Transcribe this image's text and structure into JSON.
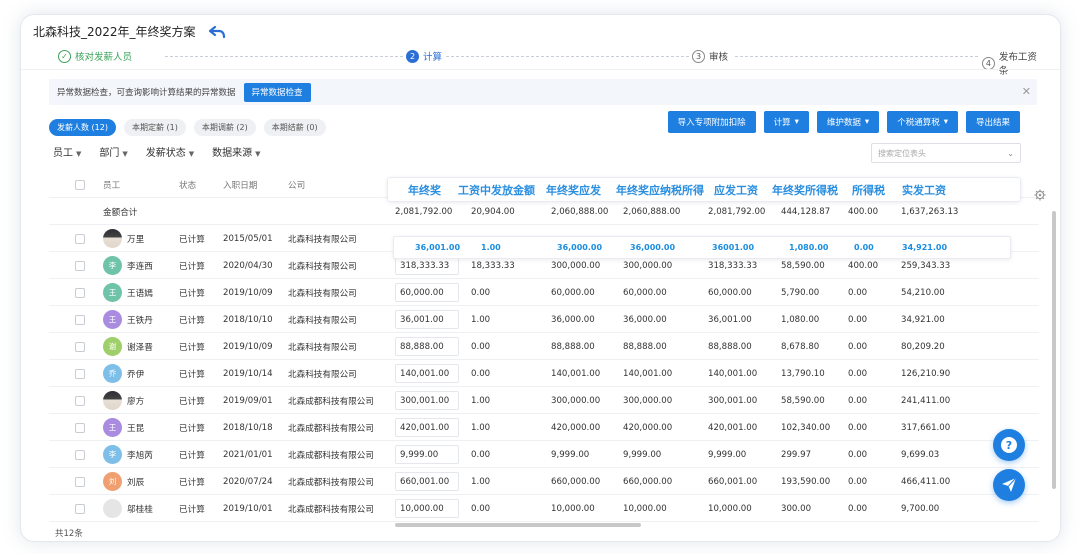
{
  "title": "北森科技_2022年_年终奖方案",
  "steps": [
    {
      "num": "✓",
      "label": "核对发薪人员",
      "state": "done"
    },
    {
      "num": "2",
      "label": "计算",
      "state": "active"
    },
    {
      "num": "3",
      "label": "审核",
      "state": "todo"
    },
    {
      "num": "4",
      "label": "发布工资条",
      "state": "todo"
    }
  ],
  "notice": {
    "text": "异常数据检查，可查询影响计算结果的异常数据",
    "button": "异常数据检查"
  },
  "toolbar": {
    "import": "导入专项附加扣除",
    "calc": "计算",
    "maintain": "维护数据",
    "tax": "个税通算税",
    "export": "导出结果"
  },
  "tabs": [
    "发薪人数 (12)",
    "本期定薪 (1)",
    "本期调薪 (2)",
    "本期结薪 (0)"
  ],
  "filters": [
    "员工",
    "部门",
    "发薪状态",
    "数据来源"
  ],
  "column_search": {
    "placeholder": "搜索定位表头"
  },
  "columns": [
    "员工",
    "状态",
    "入职日期",
    "公司"
  ],
  "overlay_columns": [
    "年终奖",
    "工资中发放金额",
    "年终奖应发",
    "年终奖应纳税所得",
    "应发工资",
    "年终奖所得税",
    "所得税",
    "实发工资"
  ],
  "totals": {
    "label": "金额合计",
    "values": [
      "2,081,792.00",
      "20,904.00",
      "2,060,888.00",
      "2,060,888.00",
      "2,081,792.00",
      "444,128.87",
      "400.00",
      "1,637,263.13"
    ]
  },
  "highlight_row": [
    "36,001.00",
    "1.00",
    "36,000.00",
    "36,000.00",
    "36001.00",
    "1,080.00",
    "0.00",
    "34,921.00"
  ],
  "rows": [
    {
      "avatar": "",
      "avatar_color": "#555555",
      "photo": true,
      "name": "万里",
      "status": "已计算",
      "date": "2015/05/01",
      "company": "北森科技有限公司",
      "values": []
    },
    {
      "avatar": "李",
      "avatar_color": "#6fc3a8",
      "photo": false,
      "name": "李连西",
      "status": "已计算",
      "date": "2020/04/30",
      "company": "北森科技有限公司",
      "values": [
        "318,333.33",
        "18,333.33",
        "300,000.00",
        "300,000.00",
        "318,333.33",
        "58,590.00",
        "400.00",
        "259,343.33"
      ]
    },
    {
      "avatar": "王",
      "avatar_color": "#6fc3a8",
      "photo": false,
      "name": "王语嫣",
      "status": "已计算",
      "date": "2019/10/09",
      "company": "北森科技有限公司",
      "values": [
        "60,000.00",
        "0.00",
        "60,000.00",
        "60,000.00",
        "60,000.00",
        "5,790.00",
        "0.00",
        "54,210.00"
      ]
    },
    {
      "avatar": "王",
      "avatar_color": "#a98be0",
      "photo": false,
      "name": "王铁丹",
      "status": "已计算",
      "date": "2018/10/10",
      "company": "北森科技有限公司",
      "values": [
        "36,001.00",
        "1.00",
        "36,000.00",
        "36,000.00",
        "36,001.00",
        "1,080.00",
        "0.00",
        "34,921.00"
      ]
    },
    {
      "avatar": "谢",
      "avatar_color": "#9fcf6a",
      "photo": false,
      "name": "谢泽晋",
      "status": "已计算",
      "date": "2019/10/09",
      "company": "北森科技有限公司",
      "values": [
        "88,888.00",
        "0.00",
        "88,888.00",
        "88,888.00",
        "88,888.00",
        "8,678.80",
        "0.00",
        "80,209.20"
      ]
    },
    {
      "avatar": "乔",
      "avatar_color": "#7dbfe8",
      "photo": false,
      "name": "乔伊",
      "status": "已计算",
      "date": "2019/10/14",
      "company": "北森科技有限公司",
      "values": [
        "140,001.00",
        "0.00",
        "140,001.00",
        "140,001.00",
        "140,001.00",
        "13,790.10",
        "0.00",
        "126,210.90"
      ]
    },
    {
      "avatar": "",
      "avatar_color": "#444444",
      "photo": true,
      "name": "廖方",
      "status": "已计算",
      "date": "2019/09/01",
      "company": "北森成都科技有限公司",
      "values": [
        "300,001.00",
        "1.00",
        "300,000.00",
        "300,000.00",
        "300,001.00",
        "58,590.00",
        "0.00",
        "241,411.00"
      ]
    },
    {
      "avatar": "王",
      "avatar_color": "#a98be0",
      "photo": false,
      "name": "王昆",
      "status": "已计算",
      "date": "2018/10/18",
      "company": "北森成都科技有限公司",
      "values": [
        "420,001.00",
        "1.00",
        "420,000.00",
        "420,000.00",
        "420,001.00",
        "102,340.00",
        "0.00",
        "317,661.00"
      ]
    },
    {
      "avatar": "李",
      "avatar_color": "#7dbfe8",
      "photo": false,
      "name": "李旭芮",
      "status": "已计算",
      "date": "2021/01/01",
      "company": "北森成都科技有限公司",
      "values": [
        "9,999.00",
        "0.00",
        "9,999.00",
        "9,999.00",
        "9,999.00",
        "299.97",
        "0.00",
        "9,699.03"
      ]
    },
    {
      "avatar": "刘",
      "avatar_color": "#f0a070",
      "photo": false,
      "name": "刘辰",
      "status": "已计算",
      "date": "2020/07/24",
      "company": "北森成都科技有限公司",
      "values": [
        "660,001.00",
        "1.00",
        "660,000.00",
        "660,000.00",
        "660,001.00",
        "193,590.00",
        "0.00",
        "466,411.00"
      ]
    },
    {
      "avatar": "",
      "avatar_color": "#e5e5e5",
      "photo": false,
      "name": "邬桂桂",
      "status": "已计算",
      "date": "2019/10/01",
      "company": "北森成都科技有限公司",
      "values": [
        "10,000.00",
        "0.00",
        "10,000.00",
        "10,000.00",
        "10,000.00",
        "300.00",
        "0.00",
        "9,700.00"
      ]
    }
  ],
  "footer": {
    "count": "共12条"
  },
  "colors": {
    "primary": "#1f7fe0",
    "done": "#3aa35a",
    "overlay_text": "#2b8fe0"
  }
}
